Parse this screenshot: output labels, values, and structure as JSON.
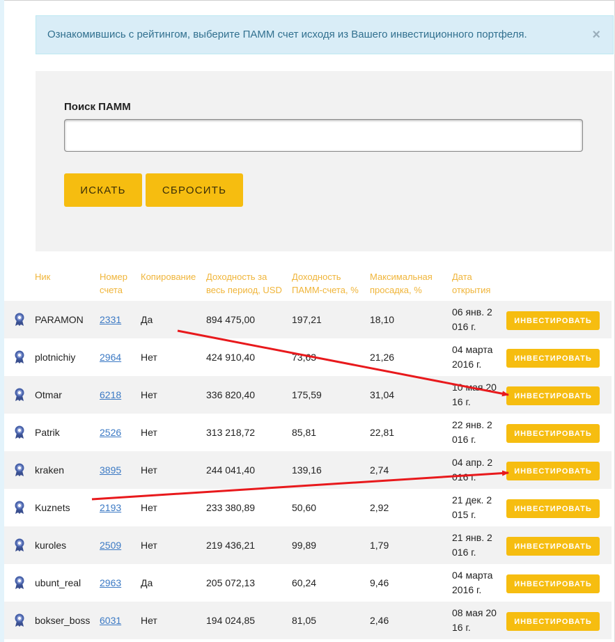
{
  "alert": {
    "text": "Ознакомившись с рейтингом, выберите ПАММ счет исходя из Вашего инвестиционного портфеля.",
    "close": "×"
  },
  "search": {
    "label": "Поиск ПАММ",
    "value": "",
    "placeholder": "",
    "search_button": "ИСКАТЬ",
    "reset_button": "СБРОСИТЬ"
  },
  "table": {
    "headers": [
      "Ник",
      "Номер счета",
      "Копирование",
      "Доходность за весь период, USD",
      "Доходность ПАММ-счета, %",
      "Максимальная просадка, %",
      "Дата открытия"
    ],
    "invest_label": "ИНВЕСТИРОВАТЬ",
    "rows": [
      {
        "nick": "PARAMON",
        "account": "2331",
        "copy": "Да",
        "yield_usd": "894 475,00",
        "yield_pct": "197,21",
        "drawdown": "18,10",
        "date": "06 янв. 2 016 г."
      },
      {
        "nick": "plotnichiy",
        "account": "2964",
        "copy": "Нет",
        "yield_usd": "424 910,40",
        "yield_pct": "73,63",
        "drawdown": "21,26",
        "date": "04 марта 2016 г."
      },
      {
        "nick": "Otmar",
        "account": "6218",
        "copy": "Нет",
        "yield_usd": "336 820,40",
        "yield_pct": "175,59",
        "drawdown": "31,04",
        "date": "10 мая 20 16 г."
      },
      {
        "nick": "Patrik",
        "account": "2526",
        "copy": "Нет",
        "yield_usd": "313 218,72",
        "yield_pct": "85,81",
        "drawdown": "22,81",
        "date": "22 янв. 2 016 г."
      },
      {
        "nick": "kraken",
        "account": "3895",
        "copy": "Нет",
        "yield_usd": "244 041,40",
        "yield_pct": "139,16",
        "drawdown": "2,74",
        "date": "04 апр. 2 016 г."
      },
      {
        "nick": "Kuznets",
        "account": "2193",
        "copy": "Нет",
        "yield_usd": "233 380,89",
        "yield_pct": "50,60",
        "drawdown": "2,92",
        "date": "21 дек. 2 015 г."
      },
      {
        "nick": "kuroles",
        "account": "2509",
        "copy": "Нет",
        "yield_usd": "219 436,21",
        "yield_pct": "99,89",
        "drawdown": "1,79",
        "date": "21 янв. 2 016 г."
      },
      {
        "nick": "ubunt_real",
        "account": "2963",
        "copy": "Да",
        "yield_usd": "205 072,13",
        "yield_pct": "60,24",
        "drawdown": "9,46",
        "date": "04 марта 2016 г."
      },
      {
        "nick": "bokser_boss",
        "account": "6031",
        "copy": "Нет",
        "yield_usd": "194 024,85",
        "yield_pct": "81,05",
        "drawdown": "2,46",
        "date": "08 мая 20 16 г."
      }
    ]
  },
  "colors": {
    "accent": "#f6bd10",
    "header_text": "#f0b53a",
    "link": "#3b79c4",
    "alert_bg": "#d9edf7",
    "annotation_arrow": "#e8191c"
  },
  "icons": {
    "row_badge": "award-badge-icon",
    "alert_close": "close-icon"
  }
}
